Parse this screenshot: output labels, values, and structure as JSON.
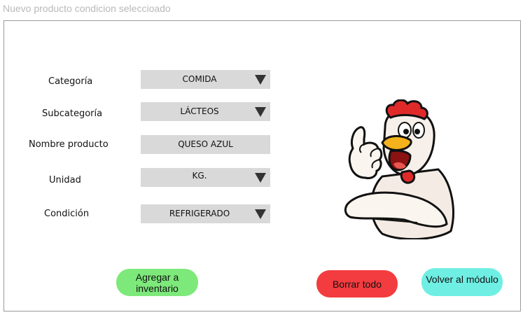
{
  "window": {
    "title": "Nuevo producto condicion seleccioado"
  },
  "form": {
    "category": {
      "label": "Categoría",
      "value": "COMIDA"
    },
    "subcategory": {
      "label": "Subcategoría",
      "value": "LÁCTEOS"
    },
    "product_name": {
      "label": "Nombre producto",
      "value": "QUESO AZUL"
    },
    "unit": {
      "label": "Unidad",
      "value": "KG."
    },
    "condition": {
      "label": "Condición",
      "value": "REFRIGERADO"
    }
  },
  "buttons": {
    "add_line1": "Agregar a",
    "add_line2": "inventario",
    "clear": "Borrar todo",
    "back": "Volver al módulo"
  },
  "colors": {
    "add": "#7de97a",
    "clear": "#f23c3f",
    "back": "#6fefe4",
    "field": "#d9d9d9"
  },
  "illustration": {
    "icon": "rooster-thumbs-up-icon"
  }
}
